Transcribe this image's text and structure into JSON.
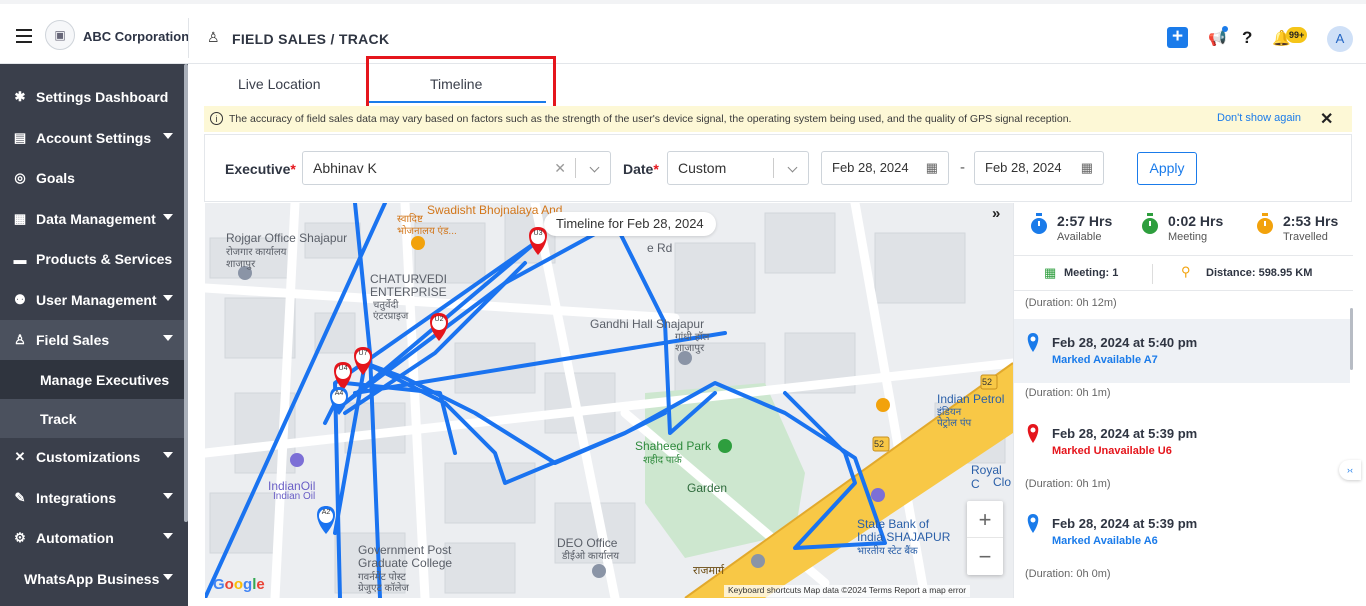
{
  "header": {
    "company": "ABC Corporation",
    "breadcrumb": "FIELD SALES / TRACK",
    "notifications_badge": "99+",
    "avatar_initial": "A",
    "add_symbol": "+",
    "help_symbol": "?"
  },
  "sidebar": {
    "items": [
      {
        "label": "Settings Dashboard",
        "icon": "gear-icon",
        "chevron": false
      },
      {
        "label": "Account Settings",
        "icon": "account-icon",
        "chevron": true
      },
      {
        "label": "Goals",
        "icon": "target-icon",
        "chevron": false
      },
      {
        "label": "Data Management",
        "icon": "table-icon",
        "chevron": true
      },
      {
        "label": "Products & Services",
        "icon": "box-icon",
        "chevron": false
      },
      {
        "label": "User Management",
        "icon": "users-icon",
        "chevron": true
      },
      {
        "label": "Field Sales",
        "icon": "person-pin-icon",
        "chevron": true
      },
      {
        "label": "Customizations",
        "icon": "tools-icon",
        "chevron": true
      },
      {
        "label": "Integrations",
        "icon": "wand-icon",
        "chevron": true
      },
      {
        "label": "Automation",
        "icon": "cogs-icon",
        "chevron": true
      },
      {
        "label": "WhatsApp Business",
        "icon": "",
        "chevron": true
      }
    ],
    "sub_items": [
      {
        "label": "Manage Executives"
      },
      {
        "label": "Track"
      }
    ]
  },
  "tabs": {
    "live": "Live Location",
    "timeline": "Timeline",
    "active": "Timeline"
  },
  "notice": {
    "text": "The accuracy of field sales data may vary based on factors such as the strength of the user's device signal, the operating system being used, and the quality of GPS signal reception.",
    "dismiss": "Don't show again"
  },
  "filters": {
    "executive_label": "Executive",
    "executive_value": "Abhinav K",
    "date_label": "Date",
    "date_value": "Custom",
    "from_date": "Feb 28, 2024",
    "to_date": "Feb 28, 2024",
    "separator": "-",
    "apply": "Apply",
    "required_mark": "*"
  },
  "map": {
    "timeline_label": "Timeline for Feb 28, 2024",
    "zoom_in": "+",
    "zoom_out": "−",
    "attribution": "Keyboard shortcuts    Map data ©2024    Terms    Report a map error",
    "places": [
      "Swadisht Bhojnalaya And",
      "स्वादिष्ट",
      "भोजनालय एंड...",
      "Rojgar Office Shajapur",
      "रोजगार कार्यालय",
      "शाजापुर",
      "CHATURVEDI",
      "ENTERPRISE",
      "चतुर्वेदी",
      "एंटरप्राइज",
      "Gandhi Hall Shajapur",
      "गांधी हॉल",
      "शाजापुर",
      "Shaheed Park",
      "शहीद पार्क",
      "Garden",
      "IndianOil",
      "Indian Oil",
      "Indian Petrol",
      "इंडियन",
      "पेट्रोल पंप",
      "Royal C",
      "Clo",
      "State Bank of",
      "India SHAJAPUR",
      "भारतीय स्टेट बैंक",
      "DEO Office",
      "डीईओ कार्यालय",
      "Government Post",
      "Graduate College",
      "गवर्नमेंट पोस्ट",
      "ग्रेजुएट कॉलेज",
      "e Rd",
      "52",
      "52",
      "राजमार्ग"
    ],
    "markers": [
      "U3",
      "U2",
      "U7",
      "U4",
      "A4",
      "A2"
    ]
  },
  "panel": {
    "stats": [
      {
        "value": "2:57 Hrs",
        "label": "Available",
        "color": "#1a7bea"
      },
      {
        "value": "0:02 Hrs",
        "label": "Meeting",
        "color": "#2e9e3e"
      },
      {
        "value": "2:53 Hrs",
        "label": "Travelled",
        "color": "#f2a20c"
      }
    ],
    "meeting": "Meeting: 1",
    "distance": "Distance: 598.95 KM",
    "events": [
      {
        "duration_before": "(Duration: 0h 12m)",
        "time": "Feb 28, 2024 at 5:40 pm",
        "status": "Marked Available A7",
        "type": "available"
      },
      {
        "duration_before": "(Duration: 0h 1m)",
        "time": "Feb 28, 2024 at 5:39 pm",
        "status": "Marked Unavailable U6",
        "type": "unavailable"
      },
      {
        "duration_before": "(Duration: 0h 1m)",
        "time": "Feb 28, 2024 at 5:39 pm",
        "status": "Marked Available A6",
        "type": "available"
      }
    ],
    "trailing_duration": "(Duration: 0h 0m)"
  },
  "colors": {
    "route": "#1a73f0",
    "accent": "#1a7bea",
    "unavailable": "#e5151c",
    "sidebar": "#3a3f4b"
  }
}
